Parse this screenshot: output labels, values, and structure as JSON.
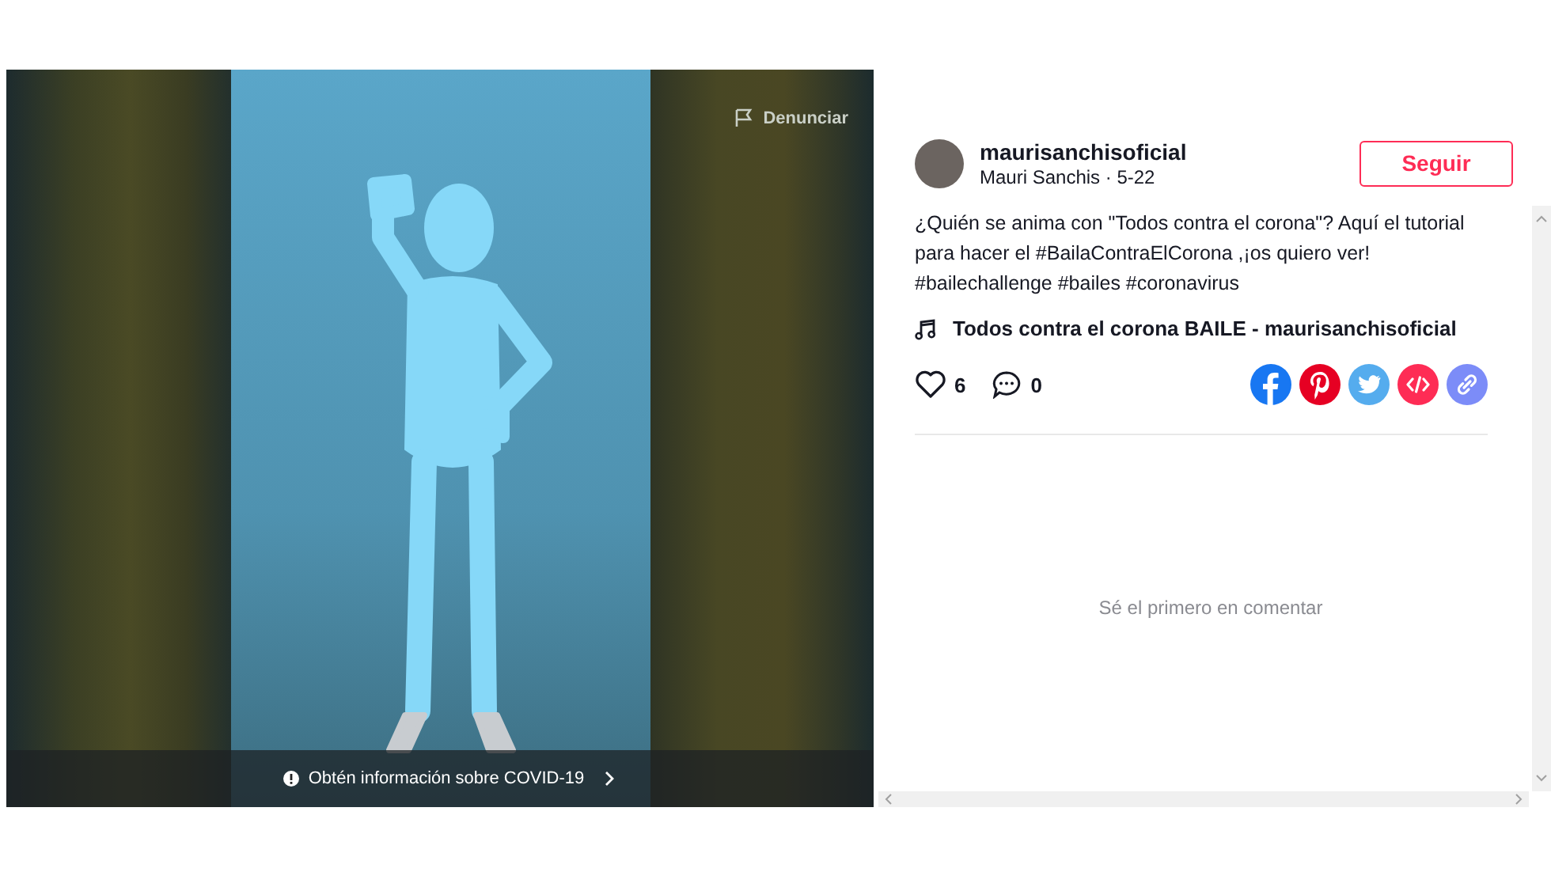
{
  "video": {
    "report_label": "Denunciar",
    "info_text": "Obtén información sobre COVID-19"
  },
  "post": {
    "username": "maurisanchisoficial",
    "byline": "Mauri Sanchis · 5-22",
    "follow_button": "Seguir",
    "caption": "¿Quién se anima con \"Todos contra el corona\"? Aquí el tutorial para hacer el #BailaContraElCorona ,¡os quiero ver! #bailechallenge #bailes #coronavirus",
    "music": "Todos contra el corona BAILE - maurisanchisoficial",
    "likes": "6",
    "comments": "0",
    "share_targets": [
      {
        "kind": "facebook",
        "color": "#1877f2"
      },
      {
        "kind": "pinterest",
        "color": "#e60023"
      },
      {
        "kind": "twitter",
        "color": "#55acee"
      },
      {
        "kind": "embed",
        "color": "#fe2c55"
      },
      {
        "kind": "link",
        "color": "#7c8cf8"
      }
    ]
  },
  "comments_empty": "Sé el primero en comentar"
}
